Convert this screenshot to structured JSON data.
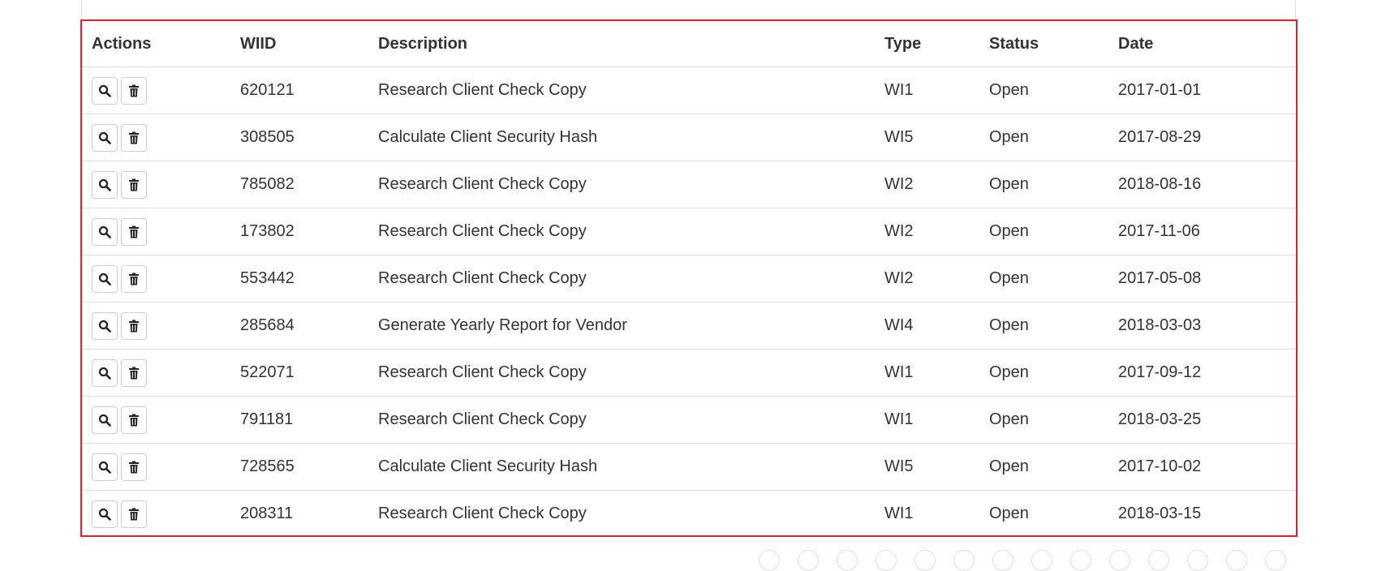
{
  "table": {
    "headers": {
      "actions": "Actions",
      "wiid": "WIID",
      "description": "Description",
      "type": "Type",
      "status": "Status",
      "date": "Date"
    },
    "rows": [
      {
        "wiid": "620121",
        "description": "Research Client Check Copy",
        "type": "WI1",
        "status": "Open",
        "date": "2017-01-01"
      },
      {
        "wiid": "308505",
        "description": "Calculate Client Security Hash",
        "type": "WI5",
        "status": "Open",
        "date": "2017-08-29"
      },
      {
        "wiid": "785082",
        "description": "Research Client Check Copy",
        "type": "WI2",
        "status": "Open",
        "date": "2018-08-16"
      },
      {
        "wiid": "173802",
        "description": "Research Client Check Copy",
        "type": "WI2",
        "status": "Open",
        "date": "2017-11-06"
      },
      {
        "wiid": "553442",
        "description": "Research Client Check Copy",
        "type": "WI2",
        "status": "Open",
        "date": "2017-05-08"
      },
      {
        "wiid": "285684",
        "description": "Generate Yearly Report for Vendor",
        "type": "WI4",
        "status": "Open",
        "date": "2018-03-03"
      },
      {
        "wiid": "522071",
        "description": "Research Client Check Copy",
        "type": "WI1",
        "status": "Open",
        "date": "2017-09-12"
      },
      {
        "wiid": "791181",
        "description": "Research Client Check Copy",
        "type": "WI1",
        "status": "Open",
        "date": "2018-03-25"
      },
      {
        "wiid": "728565",
        "description": "Calculate Client Security Hash",
        "type": "WI5",
        "status": "Open",
        "date": "2017-10-02"
      },
      {
        "wiid": "208311",
        "description": "Research Client Check Copy",
        "type": "WI1",
        "status": "Open",
        "date": "2018-03-15"
      }
    ]
  },
  "icons": {
    "view": "search-icon",
    "delete": "trash-icon"
  },
  "colors": {
    "highlight_border": "#e0202a",
    "row_divider": "#dddddd",
    "text": "#333333"
  }
}
